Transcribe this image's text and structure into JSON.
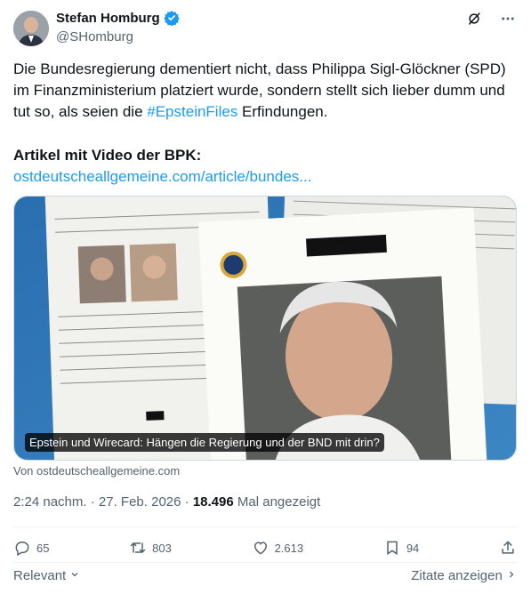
{
  "author": {
    "name": "Stefan Homburg",
    "handle": "@SHomburg",
    "verified_color": "#1d9bf0"
  },
  "tweet": {
    "text_part1": "Die Bundesregierung dementiert nicht, dass Philippa Sigl-Glöckner (SPD) im Finanzministerium platziert wurde, sondern stellt sich lieber dumm und tut so, als seien die ",
    "hashtag": "#EpsteinFiles",
    "text_part2": " Erfindungen.",
    "article_heading": "Artikel mit Video der BPK:",
    "article_link": "ostdeutscheallgemeine.com/article/bundes..."
  },
  "card": {
    "caption": "Epstein und Wirecard: Hängen die Regierung und der BND mit drin?",
    "source": "Von ostdeutscheallgemeine.com"
  },
  "meta": {
    "time": "2:24 nachm.",
    "separator": "·",
    "date": "27. Feb. 2026",
    "views_count": "18.496",
    "views_label": "Mal angezeigt"
  },
  "actions": {
    "replies": "65",
    "reposts": "803",
    "likes": "2.613",
    "bookmarks": "94"
  },
  "footer": {
    "sort_label": "Relevant",
    "quotes_label": "Zitate anzeigen"
  },
  "colors": {
    "accent": "#1d9bf0",
    "text": "#0f1419",
    "secondary": "#536471"
  }
}
